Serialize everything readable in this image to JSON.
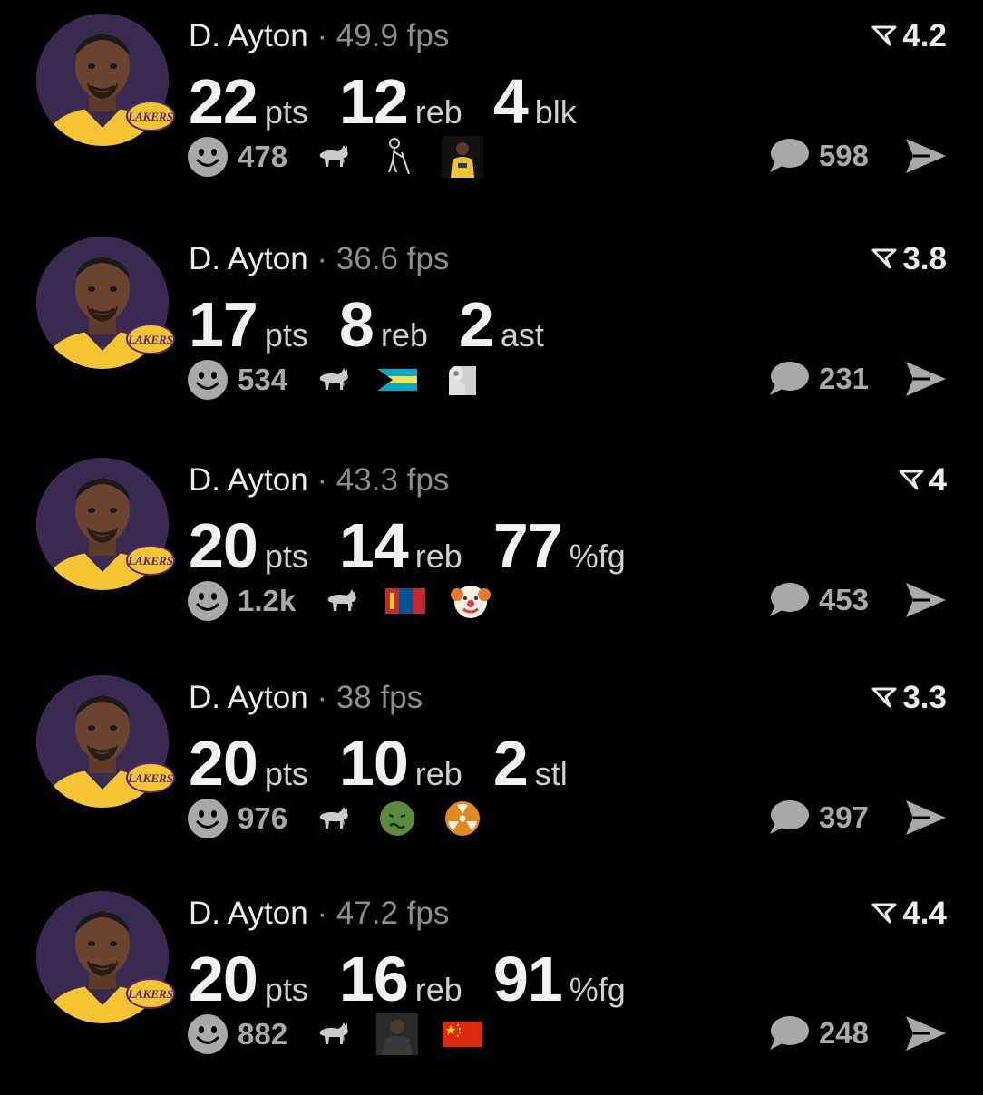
{
  "posts": [
    {
      "player": "D. Ayton",
      "separator": "·",
      "fps": "49.9 fps",
      "rating": "4.2",
      "stats": [
        {
          "num": "22",
          "unit": "pts"
        },
        {
          "num": "12",
          "unit": "reb"
        },
        {
          "num": "4",
          "unit": "blk"
        }
      ],
      "likes": "478",
      "comments": "598",
      "emojis": [
        "goat-icon",
        "old-man-cane-icon",
        "player-photo-icon"
      ]
    },
    {
      "player": "D. Ayton",
      "separator": "·",
      "fps": "36.6 fps",
      "rating": "3.8",
      "stats": [
        {
          "num": "17",
          "unit": "pts"
        },
        {
          "num": "8",
          "unit": "reb"
        },
        {
          "num": "2",
          "unit": "ast"
        }
      ],
      "likes": "534",
      "comments": "231",
      "emojis": [
        "goat-icon",
        "bahamas-flag-icon",
        "toilet-paper-icon"
      ]
    },
    {
      "player": "D. Ayton",
      "separator": "·",
      "fps": "43.3 fps",
      "rating": "4",
      "stats": [
        {
          "num": "20",
          "unit": "pts"
        },
        {
          "num": "14",
          "unit": "reb"
        },
        {
          "num": "77",
          "unit": "%fg"
        }
      ],
      "likes": "1.2k",
      "comments": "453",
      "emojis": [
        "goat-icon",
        "mongolia-flag-icon",
        "clown-face-icon"
      ]
    },
    {
      "player": "D. Ayton",
      "separator": "·",
      "fps": "38 fps",
      "rating": "3.3",
      "stats": [
        {
          "num": "20",
          "unit": "pts"
        },
        {
          "num": "10",
          "unit": "reb"
        },
        {
          "num": "2",
          "unit": "stl"
        }
      ],
      "likes": "976",
      "comments": "397",
      "emojis": [
        "goat-icon",
        "nauseated-face-icon",
        "radioactive-icon"
      ]
    },
    {
      "player": "D. Ayton",
      "separator": "·",
      "fps": "47.2 fps",
      "rating": "4.4",
      "stats": [
        {
          "num": "20",
          "unit": "pts"
        },
        {
          "num": "16",
          "unit": "reb"
        },
        {
          "num": "91",
          "unit": "%fg"
        }
      ],
      "likes": "882",
      "comments": "248",
      "emojis": [
        "goat-icon",
        "person-photo-icon",
        "china-flag-icon"
      ]
    }
  ],
  "colors": {
    "background": "#000000",
    "avatar_bg": "#3a2a52",
    "jersey": "#f4c531",
    "muted_text": "#8d8d8d",
    "icon_gray": "#a9a9a9"
  }
}
